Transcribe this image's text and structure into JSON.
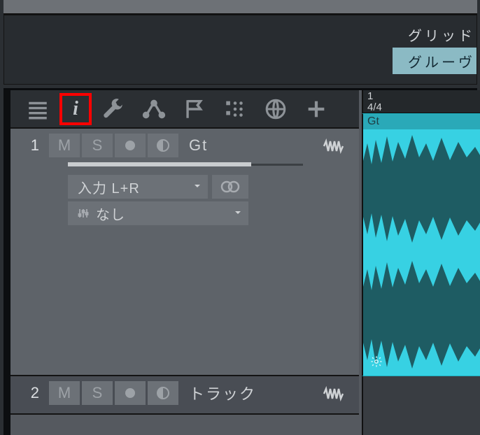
{
  "tabs": {
    "grid": "グリッド",
    "groove": "グルーヴ"
  },
  "ruler": {
    "bar": "1",
    "sig": "4/4"
  },
  "track1": {
    "num": "1",
    "mute": "M",
    "solo": "S",
    "name": "Gt",
    "input": "入力 L+R",
    "routing": "なし"
  },
  "track2": {
    "num": "2",
    "mute": "M",
    "solo": "S",
    "name": "トラック"
  },
  "clip": {
    "name": "Gt"
  }
}
